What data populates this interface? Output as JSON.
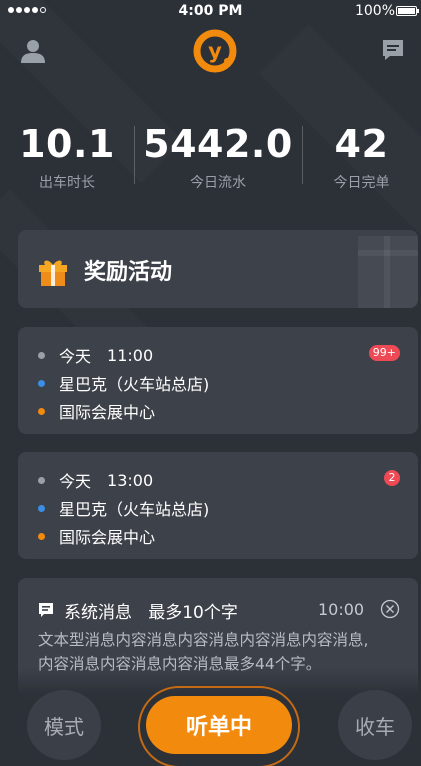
{
  "status_bar": {
    "time": "4:00 PM",
    "battery": "100%"
  },
  "header": {
    "logo_letter": "y"
  },
  "stats": [
    {
      "value_int": "10.",
      "value_dec": "1",
      "label": "出车时长"
    },
    {
      "value_int": "5442.",
      "value_dec": "0",
      "label": "今日流水"
    },
    {
      "value_int": "42",
      "value_dec": "",
      "label": "今日完单"
    }
  ],
  "reward": {
    "title": "奖励活动"
  },
  "orders": [
    {
      "day": "今天",
      "time": "11:00",
      "from": "星巴克（火车站总店)",
      "to": "国际会展中心",
      "badge": "99+"
    },
    {
      "day": "今天",
      "time": "13:00",
      "from": "星巴克（火车站总店)",
      "to": "国际会展中心",
      "badge": "2"
    }
  ],
  "system_message": {
    "title": "系统消息   最多10个字",
    "time": "10:00",
    "body_line1": "文本型消息内容消息内容消息内容消息内容消息,",
    "body_line2": "内容消息内容消息内容消息最多44个字。"
  },
  "bottom": {
    "mode_label": "模式",
    "listen_label": "听单中",
    "close_label": "收车"
  },
  "colors": {
    "background": "#2c3037",
    "card": "#3d4149",
    "accent_orange": "#f28a0e",
    "badge_red": "#ee4a56",
    "dot_blue": "#3a8ee6",
    "dot_orange": "#f28a0e",
    "dot_gray": "#9aa0a8"
  },
  "icons": {
    "profile": "user-icon",
    "logo": "brand-logo",
    "message": "chat-bubble-icon",
    "gift": "gift-icon",
    "message_card": "message-icon",
    "close": "close-circle-icon"
  }
}
